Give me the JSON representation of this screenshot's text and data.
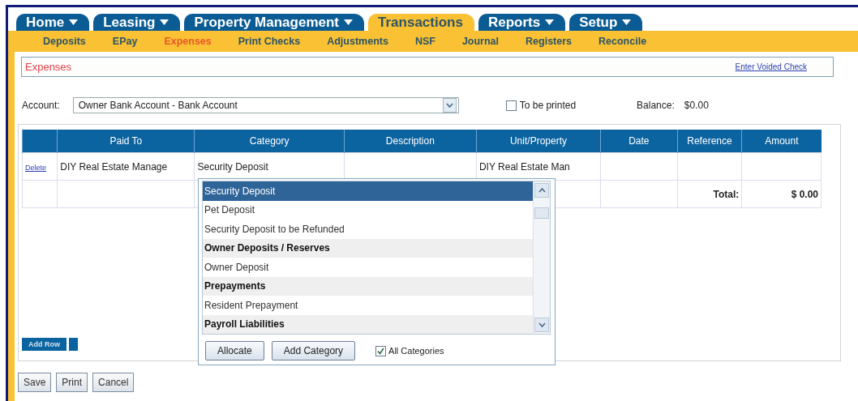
{
  "tabs": [
    {
      "label": "Home",
      "dropdown": true,
      "selected": false
    },
    {
      "label": "Leasing",
      "dropdown": true,
      "selected": false
    },
    {
      "label": "Property Management",
      "dropdown": true,
      "selected": false
    },
    {
      "label": "Transactions",
      "dropdown": false,
      "selected": true
    },
    {
      "label": "Reports",
      "dropdown": true,
      "selected": false
    },
    {
      "label": "Setup",
      "dropdown": true,
      "selected": false
    }
  ],
  "subnav": [
    {
      "label": "Deposits",
      "selected": false
    },
    {
      "label": "EPay",
      "selected": false
    },
    {
      "label": "Expenses",
      "selected": true
    },
    {
      "label": "Print Checks",
      "selected": false
    },
    {
      "label": "Adjustments",
      "selected": false
    },
    {
      "label": "NSF",
      "selected": false
    },
    {
      "label": "Journal",
      "selected": false
    },
    {
      "label": "Registers",
      "selected": false
    },
    {
      "label": "Reconcile",
      "selected": false
    }
  ],
  "section": {
    "title": "Expenses",
    "link": "Enter Voided Check"
  },
  "account": {
    "label": "Account:",
    "value": "Owner Bank Account - Bank Account",
    "to_be_printed": {
      "label": "To be printed",
      "checked": false
    },
    "balance_label": "Balance:",
    "balance": "$0.00"
  },
  "table": {
    "columns": [
      "Paid To",
      "Category",
      "Description",
      "Unit/Property",
      "Date",
      "Reference",
      "Amount"
    ],
    "rows": [
      {
        "action": "Delete",
        "paid_to": "DIY Real Estate Manage",
        "category": "Security Deposit",
        "unit": "DIY Real Estate Man"
      }
    ],
    "total_label": "Total:",
    "total": "$ 0.00"
  },
  "add_row": "Add Row",
  "category_dropdown": {
    "items": [
      {
        "label": "Security Deposit",
        "kind": "option",
        "selected": true
      },
      {
        "label": "Pet Deposit",
        "kind": "option",
        "selected": false
      },
      {
        "label": "Security Deposit to be Refunded",
        "kind": "option",
        "selected": false
      },
      {
        "label": "Owner Deposits / Reserves",
        "kind": "group",
        "selected": false
      },
      {
        "label": "Owner Deposit",
        "kind": "option",
        "selected": false
      },
      {
        "label": "Prepayments",
        "kind": "group",
        "selected": false
      },
      {
        "label": "Resident Prepayment",
        "kind": "option",
        "selected": false
      },
      {
        "label": "Payroll Liabilities",
        "kind": "group",
        "selected": false
      }
    ],
    "buttons": [
      "Allocate",
      "Add Category"
    ],
    "all_categories": {
      "label": "All Categories",
      "checked": true
    }
  },
  "buttons": [
    "Save",
    "Print",
    "Cancel"
  ]
}
